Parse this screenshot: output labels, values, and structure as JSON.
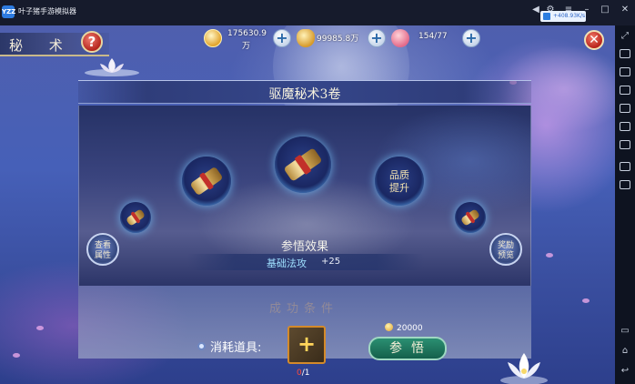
{
  "emulator": {
    "logo": "YZZ",
    "title": "叶子猪手游模拟器",
    "net_label": "+408.93K/s"
  },
  "game": {
    "header_title": "秘 术",
    "help_label": "?",
    "resources": [
      {
        "name": "copper-coin",
        "value": "175630.9",
        "unit": "万"
      },
      {
        "name": "gold-ingot",
        "value": "99985.8万"
      },
      {
        "name": "peach-stamina",
        "value": "154/77"
      }
    ],
    "plus_label": "+",
    "close_label": "✕",
    "panel": {
      "title": "驱魔秘术3卷",
      "quality_button": [
        "品质",
        "提升"
      ],
      "view_attr_button": [
        "查看",
        "属性"
      ],
      "reward_preview_button": [
        "奖励",
        "预览"
      ],
      "effect_title": "参悟效果",
      "effect_label": "基础法攻",
      "effect_value": "+25",
      "faded_text": "成功条件"
    },
    "consume": {
      "label": "消耗道具:",
      "item_plus": "+",
      "count_have": "0",
      "count_need": "/1",
      "cost": "20000",
      "comprehend_label": "参悟"
    }
  }
}
